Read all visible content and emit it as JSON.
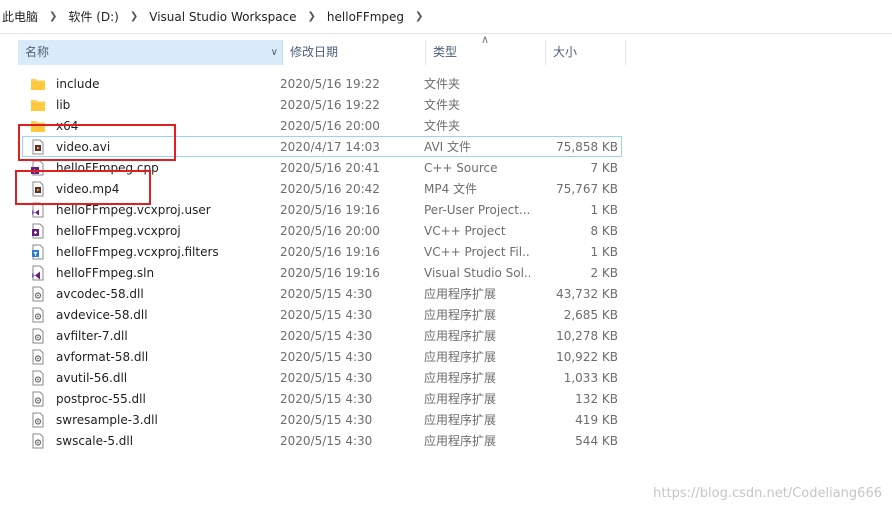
{
  "breadcrumb": [
    "此电脑",
    "软件 (D:)",
    "Visual Studio Workspace",
    "helloFFmpeg"
  ],
  "columns": {
    "name": "名称",
    "date": "修改日期",
    "type": "类型",
    "size": "大小"
  },
  "files": [
    {
      "name": "include",
      "date": "2020/5/16 19:22",
      "type": "文件夹",
      "size": "",
      "icon": "folder-icon"
    },
    {
      "name": "lib",
      "date": "2020/5/16 19:22",
      "type": "文件夹",
      "size": "",
      "icon": "folder-icon"
    },
    {
      "name": "x64",
      "date": "2020/5/16 20:00",
      "type": "文件夹",
      "size": "",
      "icon": "folder-icon"
    },
    {
      "name": "video.avi",
      "date": "2020/4/17 14:03",
      "type": "AVI 文件",
      "size": "75,858 KB",
      "icon": "video-file-icon"
    },
    {
      "name": "helloFFmpeg.cpp",
      "date": "2020/5/16 20:41",
      "type": "C++ Source",
      "size": "7 KB",
      "icon": "cpp-file-icon"
    },
    {
      "name": "video.mp4",
      "date": "2020/5/16 20:42",
      "type": "MP4 文件",
      "size": "75,767 KB",
      "icon": "video-file-icon"
    },
    {
      "name": "helloFFmpeg.vcxproj.user",
      "date": "2020/5/16 19:16",
      "type": "Per-User Project...",
      "size": "1 KB",
      "icon": "vs-user-file-icon"
    },
    {
      "name": "helloFFmpeg.vcxproj",
      "date": "2020/5/16 20:00",
      "type": "VC++ Project",
      "size": "8 KB",
      "icon": "vcxproj-file-icon"
    },
    {
      "name": "helloFFmpeg.vcxproj.filters",
      "date": "2020/5/16 19:16",
      "type": "VC++ Project Fil...",
      "size": "1 KB",
      "icon": "filters-file-icon"
    },
    {
      "name": "helloFFmpeg.sln",
      "date": "2020/5/16 19:16",
      "type": "Visual Studio Sol...",
      "size": "2 KB",
      "icon": "sln-file-icon"
    },
    {
      "name": "avcodec-58.dll",
      "date": "2020/5/15 4:30",
      "type": "应用程序扩展",
      "size": "43,732 KB",
      "icon": "dll-file-icon"
    },
    {
      "name": "avdevice-58.dll",
      "date": "2020/5/15 4:30",
      "type": "应用程序扩展",
      "size": "2,685 KB",
      "icon": "dll-file-icon"
    },
    {
      "name": "avfilter-7.dll",
      "date": "2020/5/15 4:30",
      "type": "应用程序扩展",
      "size": "10,278 KB",
      "icon": "dll-file-icon"
    },
    {
      "name": "avformat-58.dll",
      "date": "2020/5/15 4:30",
      "type": "应用程序扩展",
      "size": "10,922 KB",
      "icon": "dll-file-icon"
    },
    {
      "name": "avutil-56.dll",
      "date": "2020/5/15 4:30",
      "type": "应用程序扩展",
      "size": "1,033 KB",
      "icon": "dll-file-icon"
    },
    {
      "name": "postproc-55.dll",
      "date": "2020/5/15 4:30",
      "type": "应用程序扩展",
      "size": "132 KB",
      "icon": "dll-file-icon"
    },
    {
      "name": "swresample-3.dll",
      "date": "2020/5/15 4:30",
      "type": "应用程序扩展",
      "size": "419 KB",
      "icon": "dll-file-icon"
    },
    {
      "name": "swscale-5.dll",
      "date": "2020/5/15 4:30",
      "type": "应用程序扩展",
      "size": "544 KB",
      "icon": "dll-file-icon"
    }
  ],
  "watermark": "https://blog.csdn.net/Codeliang666",
  "colors": {
    "header_active": "#d9ebf9",
    "highlight": "#e02020",
    "selection": "#99d1ff"
  }
}
